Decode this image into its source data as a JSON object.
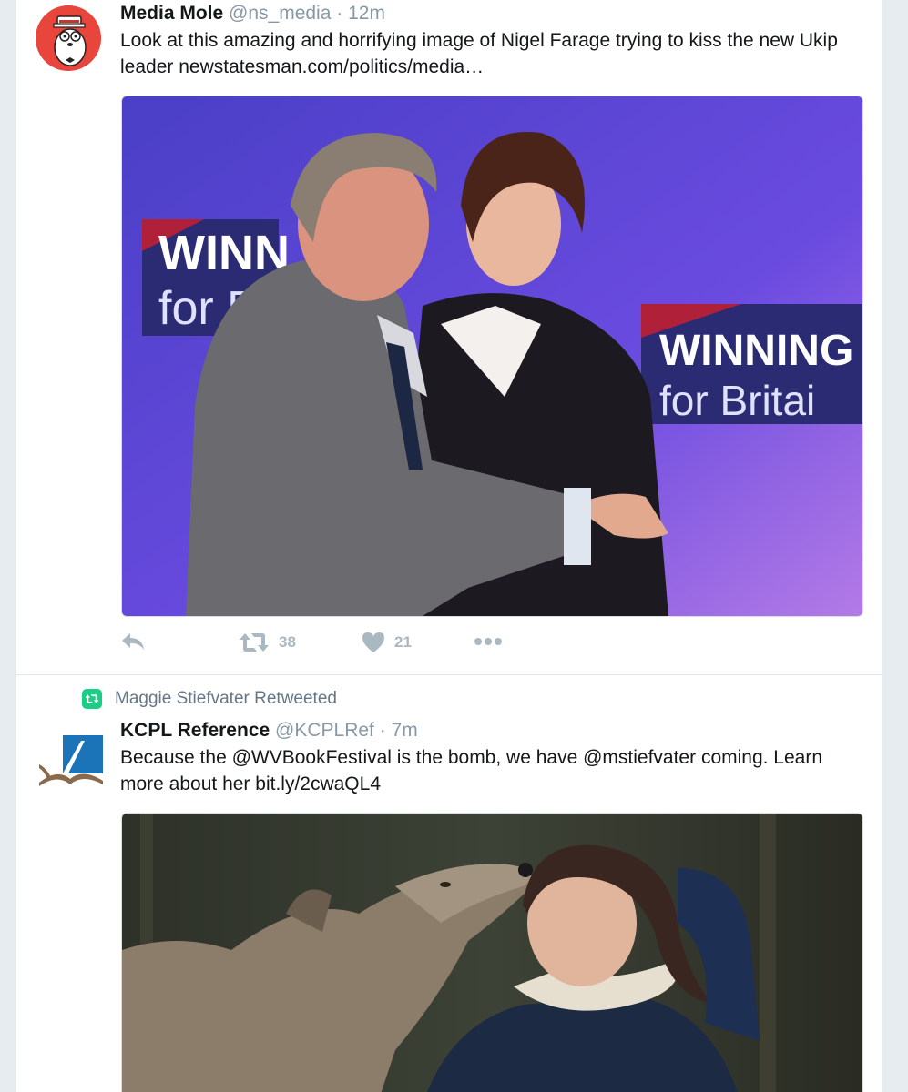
{
  "tweets": [
    {
      "name": "Media Mole",
      "handle": "@ns_media",
      "separator": "·",
      "time": "12m",
      "text": "Look at this amazing and horrifying image of Nigel Farage trying to kiss the new Ukip leader ",
      "link": "newstatesman.com/politics/media…",
      "avatar_icon": "mole-mascot-icon",
      "media": {
        "description_icon": "photo",
        "signs": [
          {
            "line1": "WINN",
            "line2": "for B"
          },
          {
            "line1": "WINNING",
            "line2": "for Britai"
          }
        ]
      },
      "actions": {
        "reply_icon": "reply-icon",
        "retweet_icon": "retweet-icon",
        "retweet_count": "38",
        "like_icon": "heart-icon",
        "like_count": "21",
        "more_icon": "more-dots-icon"
      }
    },
    {
      "retweeted_by": "Maggie Stiefvater Retweeted",
      "name": "KCPL Reference",
      "handle": "@KCPLRef",
      "separator": "·",
      "time": "7m",
      "text_part1": "Because the ",
      "mention1": "@WVBookFestival",
      "text_part2": " is the bomb, we have ",
      "mention2": "@mstiefvater",
      "text_part3": " coming. Learn more about her ",
      "link": "bit.ly/2cwaQL4",
      "avatar_icon": "library-logo-icon"
    }
  ],
  "colors": {
    "background": "#e6ecf0",
    "text": "#14171a",
    "muted": "#8899a6",
    "action_gray": "#aab8c2",
    "retweet_green": "#19cf86"
  }
}
